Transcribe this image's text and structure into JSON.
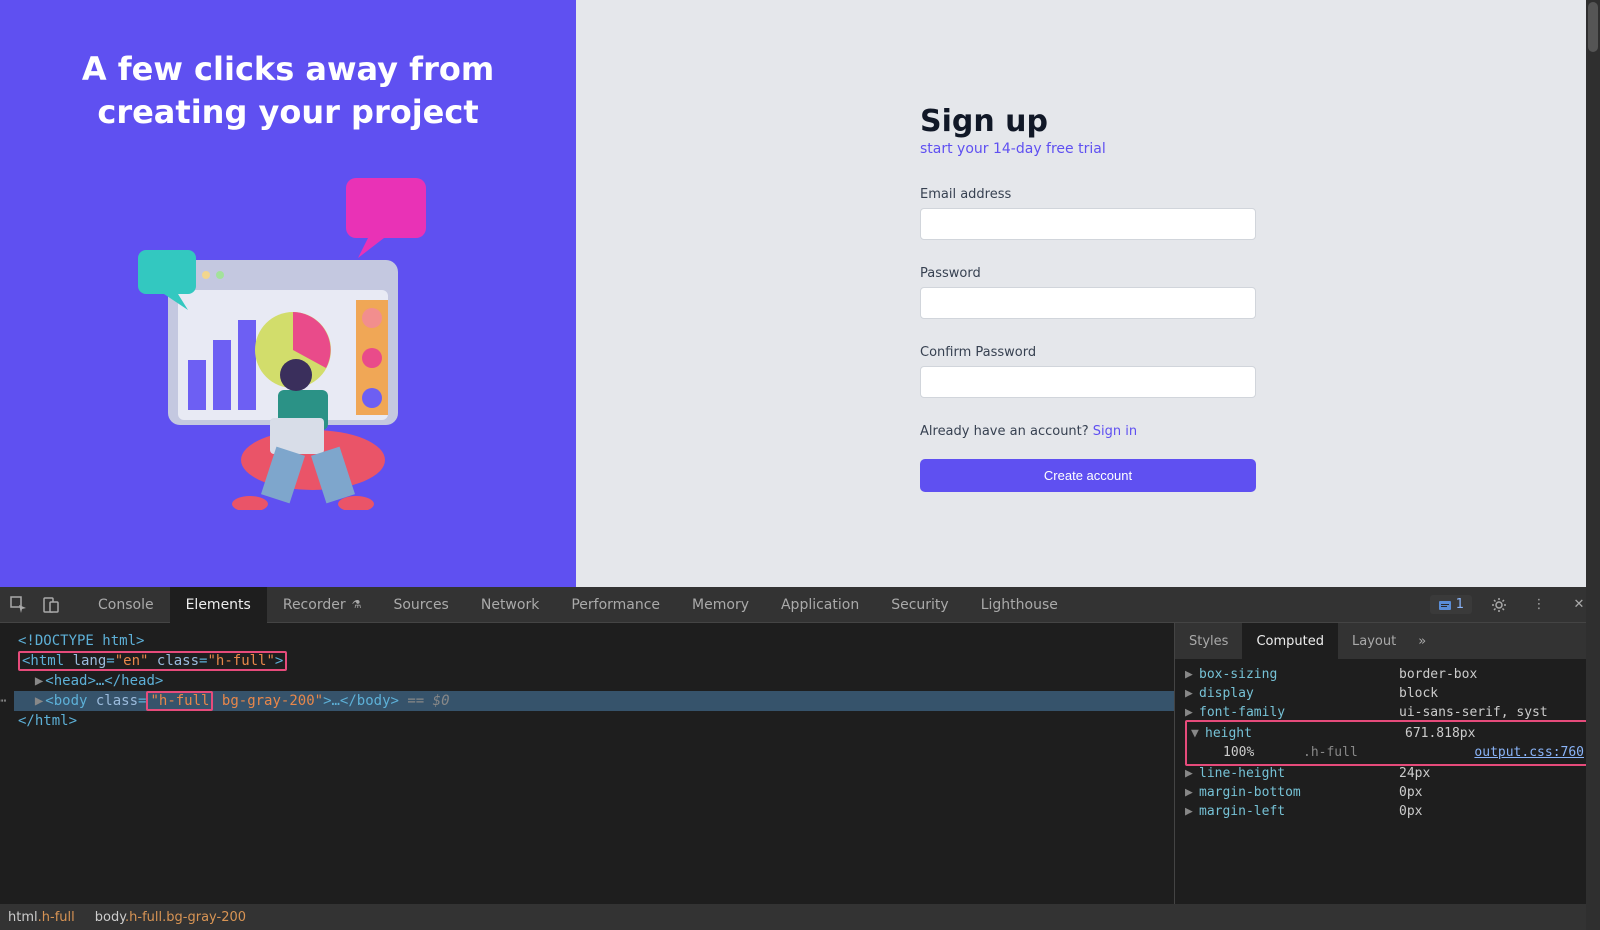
{
  "hero": {
    "headline": "A few clicks away from creating your project"
  },
  "signup": {
    "title": "Sign up",
    "subtitle": "start your 14-day free trial",
    "labels": {
      "email": "Email address",
      "password": "Password",
      "confirm": "Confirm Password"
    },
    "already_text": "Already have an account? ",
    "signin_link": "Sign in",
    "button": "Create account"
  },
  "devtools": {
    "tabs": [
      "Console",
      "Elements",
      "Recorder",
      "Sources",
      "Network",
      "Performance",
      "Memory",
      "Application",
      "Security",
      "Lighthouse"
    ],
    "active_tab": "Elements",
    "issues_count": "1",
    "dom": {
      "line1": "<!DOCTYPE html>",
      "line2_pre": "<html ",
      "line2_attr1": "lang",
      "line2_val1": "\"en\"",
      "line2_attr2": "class",
      "line2_val2": "\"h-full\"",
      "line2_post": ">",
      "line3": "<head>…</head>",
      "line4_pre": "<body ",
      "line4_attr": "class",
      "line4_val_hl": "\"h-full",
      "line4_val_rest": " bg-gray-200\"",
      "line4_post": ">…</body>",
      "line4_eq": " == $0",
      "line5": "</html>"
    },
    "side_tabs": [
      "Styles",
      "Computed",
      "Layout"
    ],
    "side_active": "Computed",
    "computed": [
      {
        "name": "box-sizing",
        "value": "border-box"
      },
      {
        "name": "display",
        "value": "block"
      },
      {
        "name": "font-family",
        "value": "ui-sans-serif, syst"
      },
      {
        "name": "height",
        "value": "671.818px",
        "sub_val": "100%",
        "sub_cls": ".h-full",
        "sub_link": "output.css:760",
        "highlighted": true
      },
      {
        "name": "line-height",
        "value": "24px"
      },
      {
        "name": "margin-bottom",
        "value": "0px"
      },
      {
        "name": "margin-left",
        "value": "0px"
      }
    ],
    "breadcrumb": [
      {
        "el": "html",
        "cls": ".h-full"
      },
      {
        "el": "body",
        "cls": ".h-full.bg-gray-200"
      }
    ]
  }
}
